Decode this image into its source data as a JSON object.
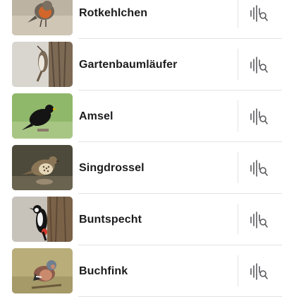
{
  "birds": [
    {
      "name": "Rotkehlchen"
    },
    {
      "name": "Gartenbaumläufer"
    },
    {
      "name": "Amsel"
    },
    {
      "name": "Singdrossel"
    },
    {
      "name": "Buntspecht"
    },
    {
      "name": "Buchfink"
    }
  ],
  "icons": {
    "row_action": "waveform-search-icon"
  }
}
